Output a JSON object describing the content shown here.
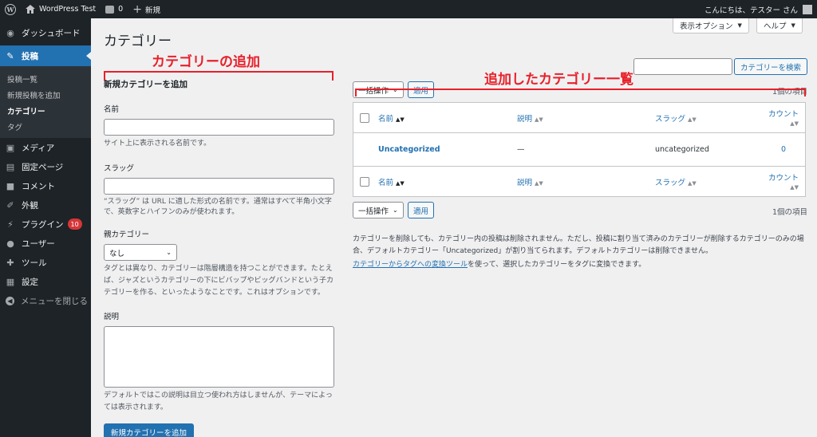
{
  "admin_bar": {
    "site_name": "WordPress Test",
    "comments_count": "0",
    "new_label": "新規",
    "greeting": "こんにちは、テスター さん"
  },
  "sidebar": {
    "dashboard": "ダッシュボード",
    "posts": "投稿",
    "submenu": [
      "投稿一覧",
      "新規投稿を追加",
      "カテゴリー",
      "タグ"
    ],
    "media": "メディア",
    "pages": "固定ページ",
    "comments": "コメント",
    "appearance": "外観",
    "plugins": "プラグイン",
    "plugins_badge": "10",
    "users": "ユーザー",
    "tools": "ツール",
    "settings": "設定",
    "collapse": "メニューを閉じる"
  },
  "header": {
    "title": "カテゴリー",
    "screen_options": "表示オプション",
    "help": "ヘルプ"
  },
  "form": {
    "heading": "新規カテゴリーを追加",
    "name_label": "名前",
    "name_help": "サイト上に表示される名前です。",
    "slug_label": "スラッグ",
    "slug_help": "“スラッグ” は URL に適した形式の名前です。通常はすべて半角小文字で、英数字とハイフンのみが使われます。",
    "parent_label": "親カテゴリー",
    "parent_value": "なし",
    "parent_help": "タグとは異なり、カテゴリーは階層構造を持つことができます。たとえば、ジャズというカテゴリーの下にビバップやビッグバンドという子カテゴリーを作る、といったようなことです。これはオプションです。",
    "desc_label": "説明",
    "desc_help": "デフォルトではこの説明は目立つ使われ方はしませんが、テーマによっては表示されます。",
    "submit": "新規カテゴリーを追加"
  },
  "list": {
    "search_button": "カテゴリーを検索",
    "bulk_action": "一括操作",
    "apply": "適用",
    "item_count": "1個の項目",
    "columns": {
      "name": "名前",
      "description": "説明",
      "slug": "スラッグ",
      "count": "カウント"
    },
    "rows": [
      {
        "name": "Uncategorized",
        "description": "—",
        "slug": "uncategorized",
        "count": "0"
      }
    ],
    "note_1": "カテゴリーを削除しても、カテゴリー内の投稿は削除されません。ただし、投稿に割り当て済みのカテゴリーが削除するカテゴリーのみの場合、デフォルトカテゴリー「Uncategorized」が割り当てられます。デフォルトカテゴリーは削除できません。",
    "note_link": "カテゴリーからタグへの変換ツール",
    "note_2": "を使って、選択したカテゴリーをタグに変換できます。"
  },
  "annotations": {
    "add_label": "カテゴリーの追加",
    "list_label": "追加したカテゴリー一覧",
    "color": "#e8202a"
  },
  "colors": {
    "accent": "#2271b1",
    "sidebar_bg": "#1d2327",
    "badge": "#d63638"
  }
}
